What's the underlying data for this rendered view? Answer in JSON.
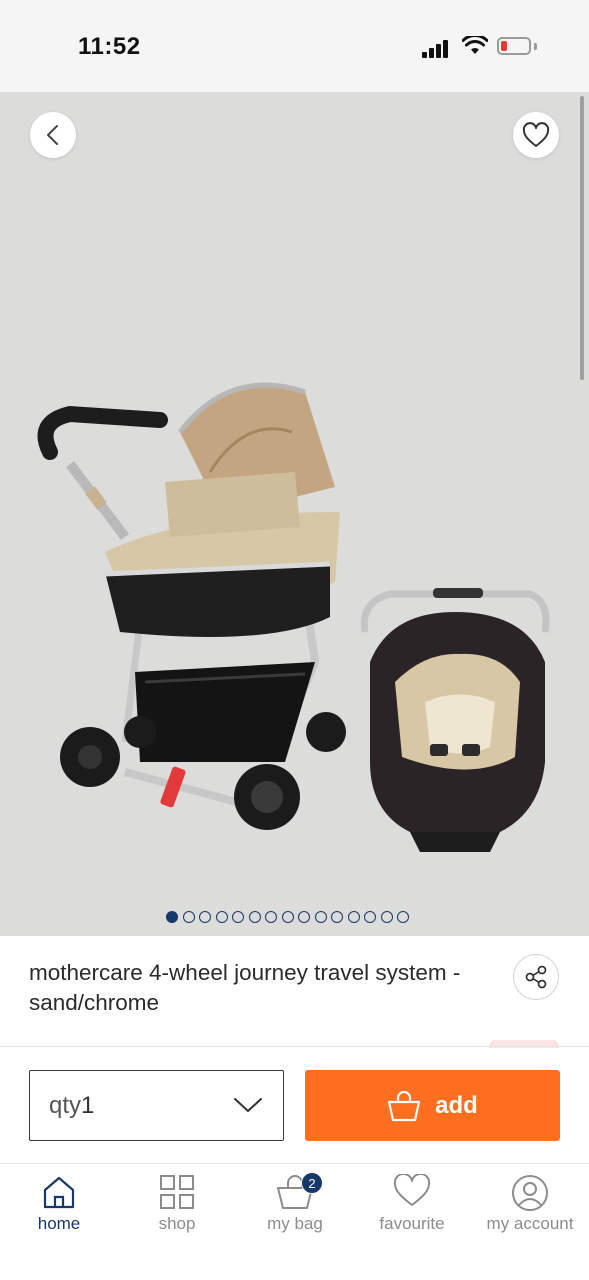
{
  "status_bar": {
    "time": "11:52",
    "icons": [
      "signal-icon",
      "wifi-icon",
      "battery-low-icon"
    ],
    "battery_color": "#e53935"
  },
  "gallery": {
    "image_count": 15,
    "active_index": 0,
    "icons": {
      "back": "chevron-left-icon",
      "favourite": "heart-outline-icon"
    }
  },
  "product": {
    "title": "mothercare 4-wheel journey travel system - sand/chrome",
    "share_icon": "share-icon"
  },
  "purchase": {
    "qty_label": "qty",
    "qty_value": "1",
    "add_label": "add",
    "add_color": "#ff6f1f"
  },
  "nav": {
    "items": [
      {
        "label": "home",
        "icon": "home-icon",
        "active": true
      },
      {
        "label": "shop",
        "icon": "grid-icon",
        "active": false
      },
      {
        "label": "my bag",
        "icon": "bag-icon",
        "active": false,
        "badge": "2"
      },
      {
        "label": "favourite",
        "icon": "heart-icon",
        "active": false
      },
      {
        "label": "my account",
        "icon": "user-icon",
        "active": false
      }
    ],
    "active_color": "#17386a",
    "inactive_color": "#8c8c8c"
  }
}
